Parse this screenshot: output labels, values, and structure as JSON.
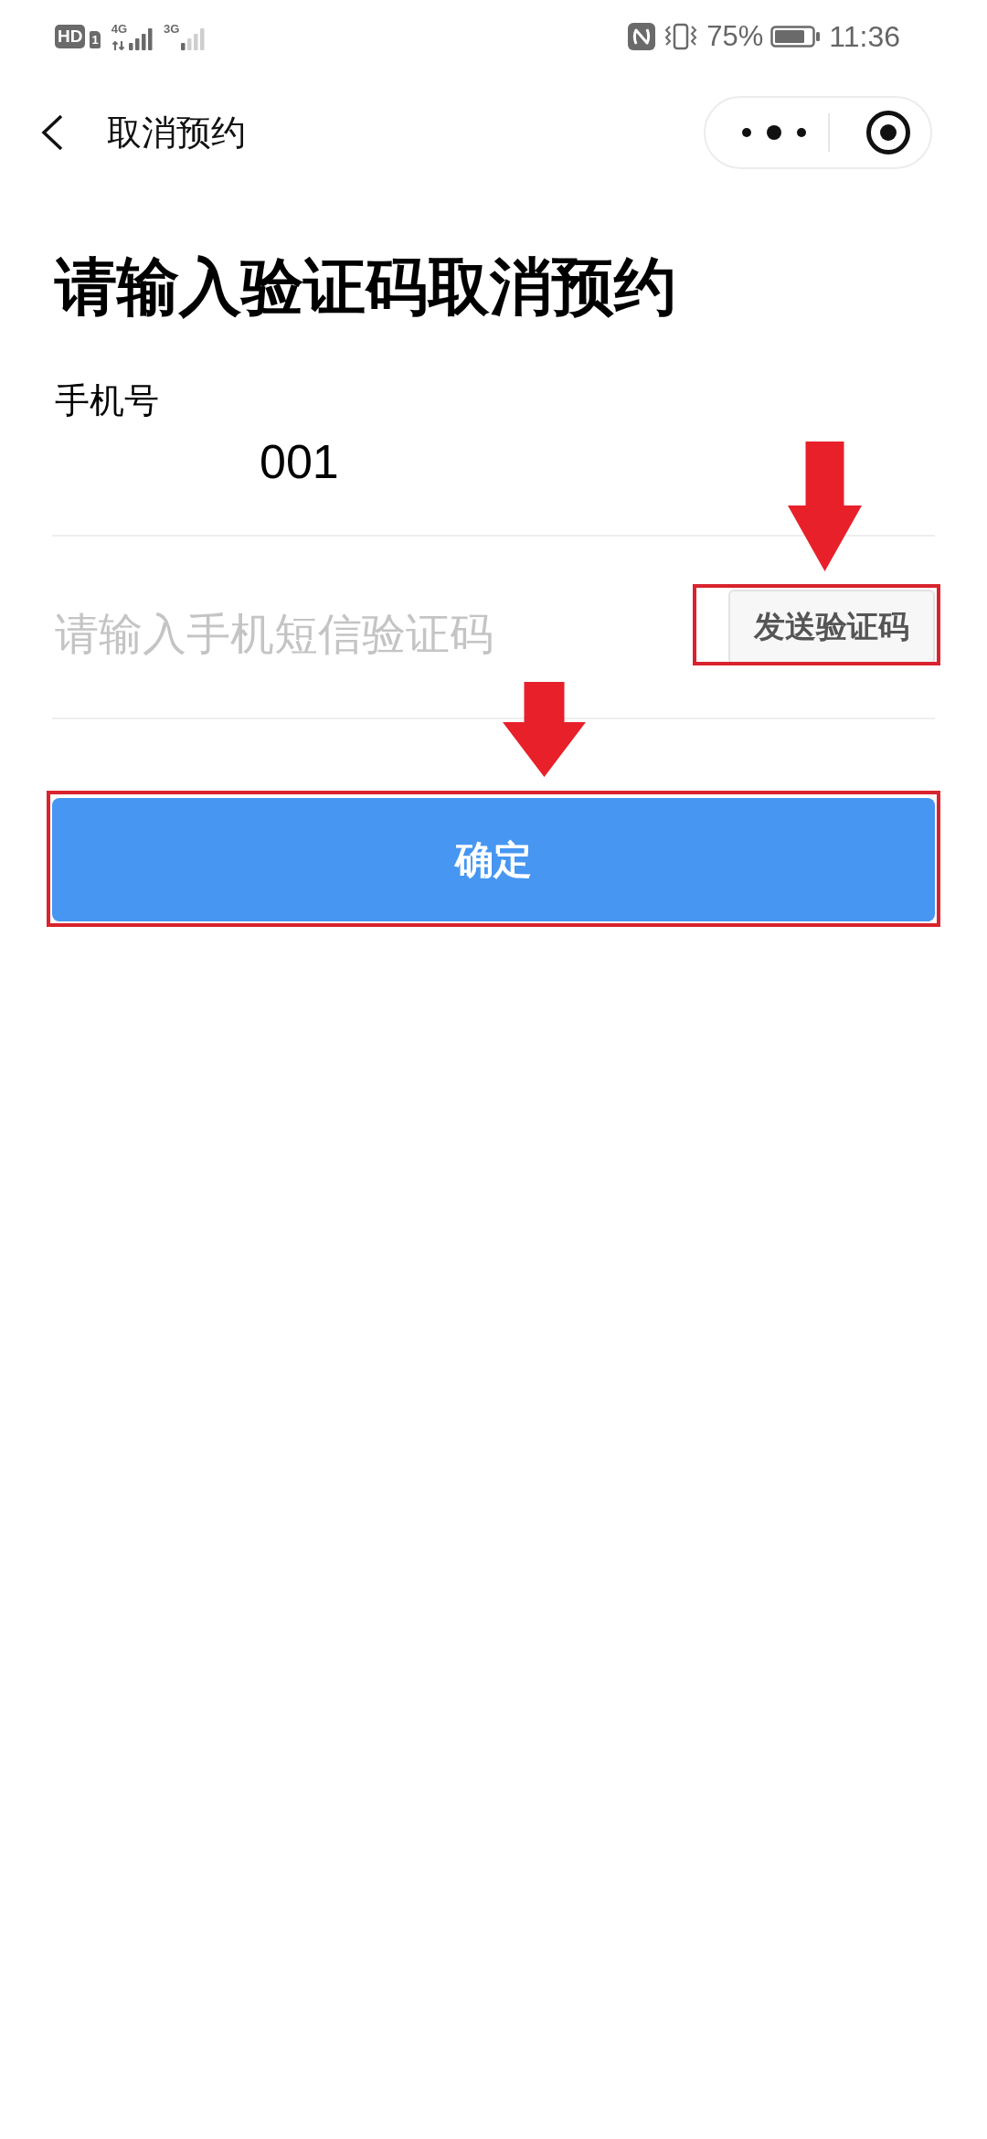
{
  "status_bar": {
    "hd_label": "HD",
    "sim_label": "1",
    "sim1_network": "4G",
    "sim2_network": "3G",
    "battery_percent": "75%",
    "time": "11:36"
  },
  "nav_bar": {
    "title": "取消预约"
  },
  "heading": "请输入验证码取消预约",
  "phone_field": {
    "label": "手机号",
    "value": "001"
  },
  "code_field": {
    "placeholder": "请输入手机短信验证码",
    "send_button": {
      "label": "发送验证码",
      "highlighted": true
    }
  },
  "confirm_button": {
    "label": "确定",
    "highlighted": true
  }
}
